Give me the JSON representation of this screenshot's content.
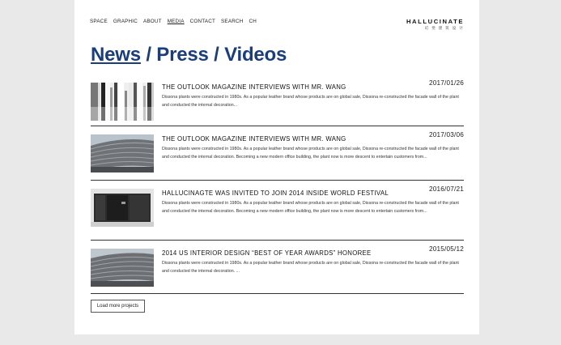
{
  "nav": {
    "items": [
      "SPACE",
      "GRAPHIC",
      "ABOUT",
      "MEDIA",
      "CONTACT",
      "SEARCH",
      "CH"
    ]
  },
  "logo": {
    "word": "HALLUCINATE",
    "sub": "幻 觉 建 筑 设 计"
  },
  "heading": {
    "news": "News",
    "rest": " / Press / Videos",
    "color": "#1a3d7c"
  },
  "articles": [
    {
      "title": "THE OUTLOOK MAGAZINE INTERVIEWS WITH MR. WANG",
      "date": "2017/01/26",
      "description": "Dissona plants were constructed in 1980s. As a popular leather brand whose products are on global sale, Dissona re-constructed the facade wall of the plant and conducted the internal decoration...",
      "image": "white-slat-facade"
    },
    {
      "title": "THE OUTLOOK MAGAZINE INTERVIEWS WITH MR. WANG",
      "date": "2017/03/06",
      "description": "Dissona plants were constructed in 1980s. As a popular leather brand whose products are on global sale, Dissona re-constructed the facade wall of the plant and conducted the internal decoration. Becoming a new modern office building, the plant now is more descent to entertain customers from...",
      "image": "grey-brick-building"
    },
    {
      "title": "HALLUCINAGTE WAS INVITED TO JOIN 2014 INSIDE WORLD FESTIVAL",
      "date": "2016/07/21",
      "description": "Dissona plants were constructed in 1980s. As a popular leather brand whose products are on global sale, Dissona re-constructed the facade wall of the plant and conducted the internal decoration. Becoming a new modern office building, the plant now is more descent to entertain customers from...",
      "image": "dark-pavilion"
    },
    {
      "title": "2014 US INTERIOR DESIGN “BEST OF YEAR AWARDS” HONOREE",
      "date": "2015/05/12",
      "description": "Dissona plants were constructed in 1980s. As a popular leather brand whose products are on global sale, Dissona re-constructed the facade wall of the plant and conducted the internal decoration. ...",
      "image": "grey-brick-building"
    }
  ],
  "load_more": "Load more projects"
}
